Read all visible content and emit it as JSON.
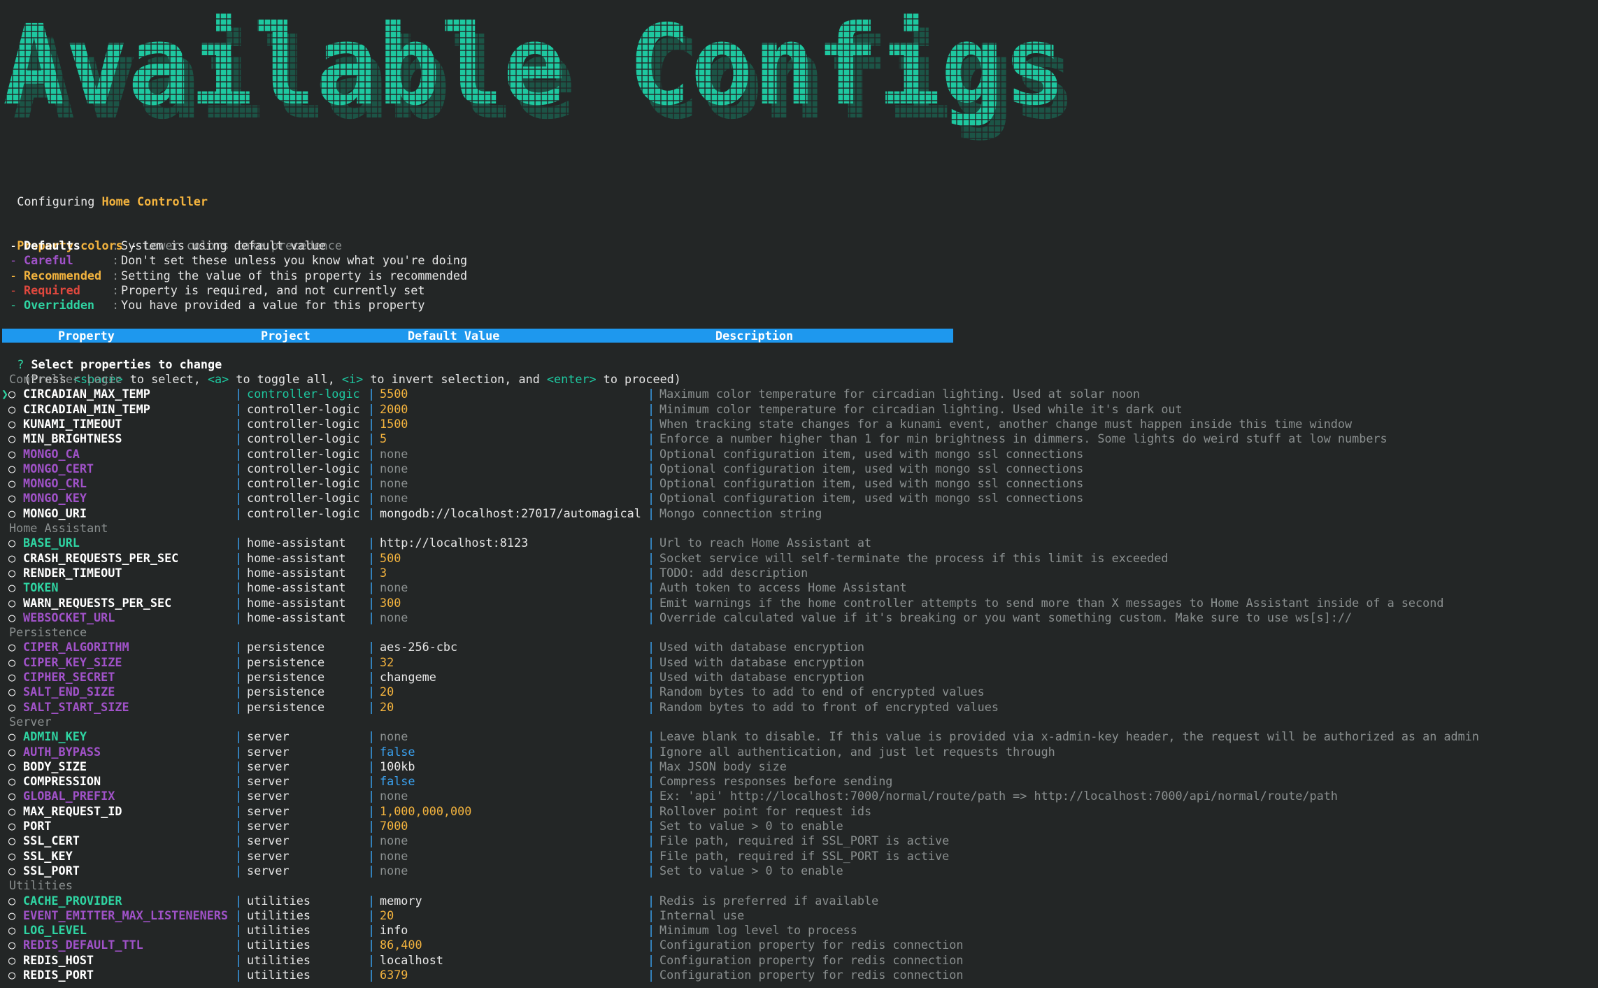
{
  "banner": {
    "text": "Available Configs"
  },
  "configuring": {
    "prefix": "Configuring ",
    "app": "Home Controller"
  },
  "legend": {
    "title": "Property colors",
    "dash": " - ",
    "subtitle": "Lower colors take precedence",
    "items": [
      {
        "name": "Defaults",
        "desc": "System is using default value",
        "color": "#ffffff"
      },
      {
        "name": "Careful",
        "desc": "Don't set these unless you know what you're doing",
        "color": "#a052c8"
      },
      {
        "name": "Recommended",
        "desc": "Setting the value of this property is recommended",
        "color": "#f3b33e"
      },
      {
        "name": "Required",
        "desc": "Property is required, and not currently set",
        "color": "#e0483e"
      },
      {
        "name": "Overridden",
        "desc": "You have provided a value for this property",
        "color": "#2fd4a2"
      }
    ]
  },
  "table_header": {
    "property": "Property",
    "project": "Project",
    "default_value": "Default Value",
    "description": "Description"
  },
  "prompt": {
    "question_mark": "?",
    "question": "Select properties to change",
    "help_parts": [
      "(Press ",
      "<space>",
      " to select, ",
      "<a>",
      " to toggle all, ",
      "<i>",
      " to invert selection, and ",
      "<enter>",
      " to proceed)"
    ]
  },
  "groups": [
    {
      "label": "Controller Logic",
      "rows": [
        {
          "name": "CIRCADIAN_MAX_TEMP",
          "kind": "default",
          "project": "controller-logic",
          "value": "5500",
          "vkind": "number",
          "desc": "Maximum color temperature for circadian lighting. Used at solar noon",
          "cursor": true
        },
        {
          "name": "CIRCADIAN_MIN_TEMP",
          "kind": "default",
          "project": "controller-logic",
          "value": "2000",
          "vkind": "number",
          "desc": "Minimum color temperature for circadian lighting. Used while it's dark out"
        },
        {
          "name": "KUNAMI_TIMEOUT",
          "kind": "default",
          "project": "controller-logic",
          "value": "1500",
          "vkind": "number",
          "desc": "When tracking state changes for a kunami event, another change must happen inside this time window"
        },
        {
          "name": "MIN_BRIGHTNESS",
          "kind": "default",
          "project": "controller-logic",
          "value": "5",
          "vkind": "number",
          "desc": "Enforce a number higher than 1 for min brightness in dimmers. Some lights do weird stuff at low numbers"
        },
        {
          "name": "MONGO_CA",
          "kind": "careful",
          "project": "controller-logic",
          "value": "none",
          "vkind": "none",
          "desc": "Optional configuration item, used with mongo ssl connections"
        },
        {
          "name": "MONGO_CERT",
          "kind": "careful",
          "project": "controller-logic",
          "value": "none",
          "vkind": "none",
          "desc": "Optional configuration item, used with mongo ssl connections"
        },
        {
          "name": "MONGO_CRL",
          "kind": "careful",
          "project": "controller-logic",
          "value": "none",
          "vkind": "none",
          "desc": "Optional configuration item, used with mongo ssl connections"
        },
        {
          "name": "MONGO_KEY",
          "kind": "careful",
          "project": "controller-logic",
          "value": "none",
          "vkind": "none",
          "desc": "Optional configuration item, used with mongo ssl connections"
        },
        {
          "name": "MONGO_URI",
          "kind": "default",
          "project": "controller-logic",
          "value": "mongodb://localhost:27017/automagical",
          "vkind": "string",
          "desc": "Mongo connection string"
        }
      ]
    },
    {
      "label": "Home Assistant",
      "rows": [
        {
          "name": "BASE_URL",
          "kind": "overridden",
          "project": "home-assistant",
          "value": "http://localhost:8123",
          "vkind": "string",
          "desc": "Url to reach Home Assistant at"
        },
        {
          "name": "CRASH_REQUESTS_PER_SEC",
          "kind": "default",
          "project": "home-assistant",
          "value": "500",
          "vkind": "number",
          "desc": "Socket service will self-terminate the process if this limit is exceeded"
        },
        {
          "name": "RENDER_TIMEOUT",
          "kind": "default",
          "project": "home-assistant",
          "value": "3",
          "vkind": "number",
          "desc": "TODO: add description"
        },
        {
          "name": "TOKEN",
          "kind": "overridden",
          "project": "home-assistant",
          "value": "none",
          "vkind": "none",
          "desc": "Auth token to access Home Assistant"
        },
        {
          "name": "WARN_REQUESTS_PER_SEC",
          "kind": "default",
          "project": "home-assistant",
          "value": "300",
          "vkind": "number",
          "desc": "Emit warnings if the home controller attempts to send more than X messages to Home Assistant inside of a second"
        },
        {
          "name": "WEBSOCKET_URL",
          "kind": "careful",
          "project": "home-assistant",
          "value": "none",
          "vkind": "none",
          "desc": "Override calculated value if it's breaking or you want something custom. Make sure to use ws[s]://"
        }
      ]
    },
    {
      "label": "Persistence",
      "rows": [
        {
          "name": "CIPER_ALGORITHM",
          "kind": "careful",
          "project": "persistence",
          "value": "aes-256-cbc",
          "vkind": "string",
          "desc": "Used with database encryption"
        },
        {
          "name": "CIPER_KEY_SIZE",
          "kind": "careful",
          "project": "persistence",
          "value": "32",
          "vkind": "number",
          "desc": "Used with database encryption"
        },
        {
          "name": "CIPHER_SECRET",
          "kind": "careful",
          "project": "persistence",
          "value": "changeme",
          "vkind": "string",
          "desc": "Used with database encryption"
        },
        {
          "name": "SALT_END_SIZE",
          "kind": "careful",
          "project": "persistence",
          "value": "20",
          "vkind": "number",
          "desc": "Random bytes to add to end of encrypted values"
        },
        {
          "name": "SALT_START_SIZE",
          "kind": "careful",
          "project": "persistence",
          "value": "20",
          "vkind": "number",
          "desc": "Random bytes to add to front of encrypted values"
        }
      ]
    },
    {
      "label": "Server",
      "rows": [
        {
          "name": "ADMIN_KEY",
          "kind": "overridden",
          "project": "server",
          "value": "none",
          "vkind": "none",
          "desc": "Leave blank to disable. If this value is provided via x-admin-key header, the request will be authorized as an admin"
        },
        {
          "name": "AUTH_BYPASS",
          "kind": "careful",
          "project": "server",
          "value": "false",
          "vkind": "bool",
          "desc": "Ignore all authentication, and just let requests through"
        },
        {
          "name": "BODY_SIZE",
          "kind": "default",
          "project": "server",
          "value": "100kb",
          "vkind": "string",
          "desc": "Max JSON body size"
        },
        {
          "name": "COMPRESSION",
          "kind": "default",
          "project": "server",
          "value": "false",
          "vkind": "bool",
          "desc": "Compress responses before sending"
        },
        {
          "name": "GLOBAL_PREFIX",
          "kind": "careful",
          "project": "server",
          "value": "none",
          "vkind": "none",
          "desc": "Ex: 'api' http://localhost:7000/normal/route/path => http://localhost:7000/api/normal/route/path"
        },
        {
          "name": "MAX_REQUEST_ID",
          "kind": "default",
          "project": "server",
          "value": "1,000,000,000",
          "vkind": "number",
          "desc": "Rollover point for request ids"
        },
        {
          "name": "PORT",
          "kind": "default",
          "project": "server",
          "value": "7000",
          "vkind": "number",
          "desc": "Set to value > 0 to enable"
        },
        {
          "name": "SSL_CERT",
          "kind": "default",
          "project": "server",
          "value": "none",
          "vkind": "none",
          "desc": "File path, required if SSL_PORT is active"
        },
        {
          "name": "SSL_KEY",
          "kind": "default",
          "project": "server",
          "value": "none",
          "vkind": "none",
          "desc": "File path, required if SSL_PORT is active"
        },
        {
          "name": "SSL_PORT",
          "kind": "default",
          "project": "server",
          "value": "none",
          "vkind": "none",
          "desc": "Set to value > 0 to enable"
        }
      ]
    },
    {
      "label": "Utilities",
      "rows": [
        {
          "name": "CACHE_PROVIDER",
          "kind": "overridden",
          "project": "utilities",
          "value": "memory",
          "vkind": "string",
          "desc": "Redis is preferred if available"
        },
        {
          "name": "EVENT_EMITTER_MAX_LISTENENERS",
          "kind": "careful",
          "project": "utilities",
          "value": "20",
          "vkind": "number",
          "desc": "Internal use"
        },
        {
          "name": "LOG_LEVEL",
          "kind": "overridden",
          "project": "utilities",
          "value": "info",
          "vkind": "string",
          "desc": "Minimum log level to process"
        },
        {
          "name": "REDIS_DEFAULT_TTL",
          "kind": "careful",
          "project": "utilities",
          "value": "86,400",
          "vkind": "number",
          "desc": "Configuration property for redis connection"
        },
        {
          "name": "REDIS_HOST",
          "kind": "default",
          "project": "utilities",
          "value": "localhost",
          "vkind": "string",
          "desc": "Configuration property for redis connection"
        },
        {
          "name": "REDIS_PORT",
          "kind": "default",
          "project": "utilities",
          "value": "6379",
          "vkind": "number",
          "desc": "Configuration property for redis connection"
        }
      ]
    }
  ],
  "colors": {
    "background": "#232626",
    "banner_front": "#1ec8a0",
    "banner_shadow": "#1c5a4a",
    "header_bar": "#1e98ee",
    "default": "#ffffff",
    "careful": "#a052c8",
    "recommended": "#f3b33e",
    "required": "#e0483e",
    "overridden": "#2fd4a2",
    "number": "#f3b33e",
    "bool": "#3aa1ef",
    "none": "#8a8f8f",
    "separator": "#3aa1ef"
  },
  "icons": {
    "cursor": "pointer-icon",
    "checkbox": "empty-circle-icon"
  }
}
